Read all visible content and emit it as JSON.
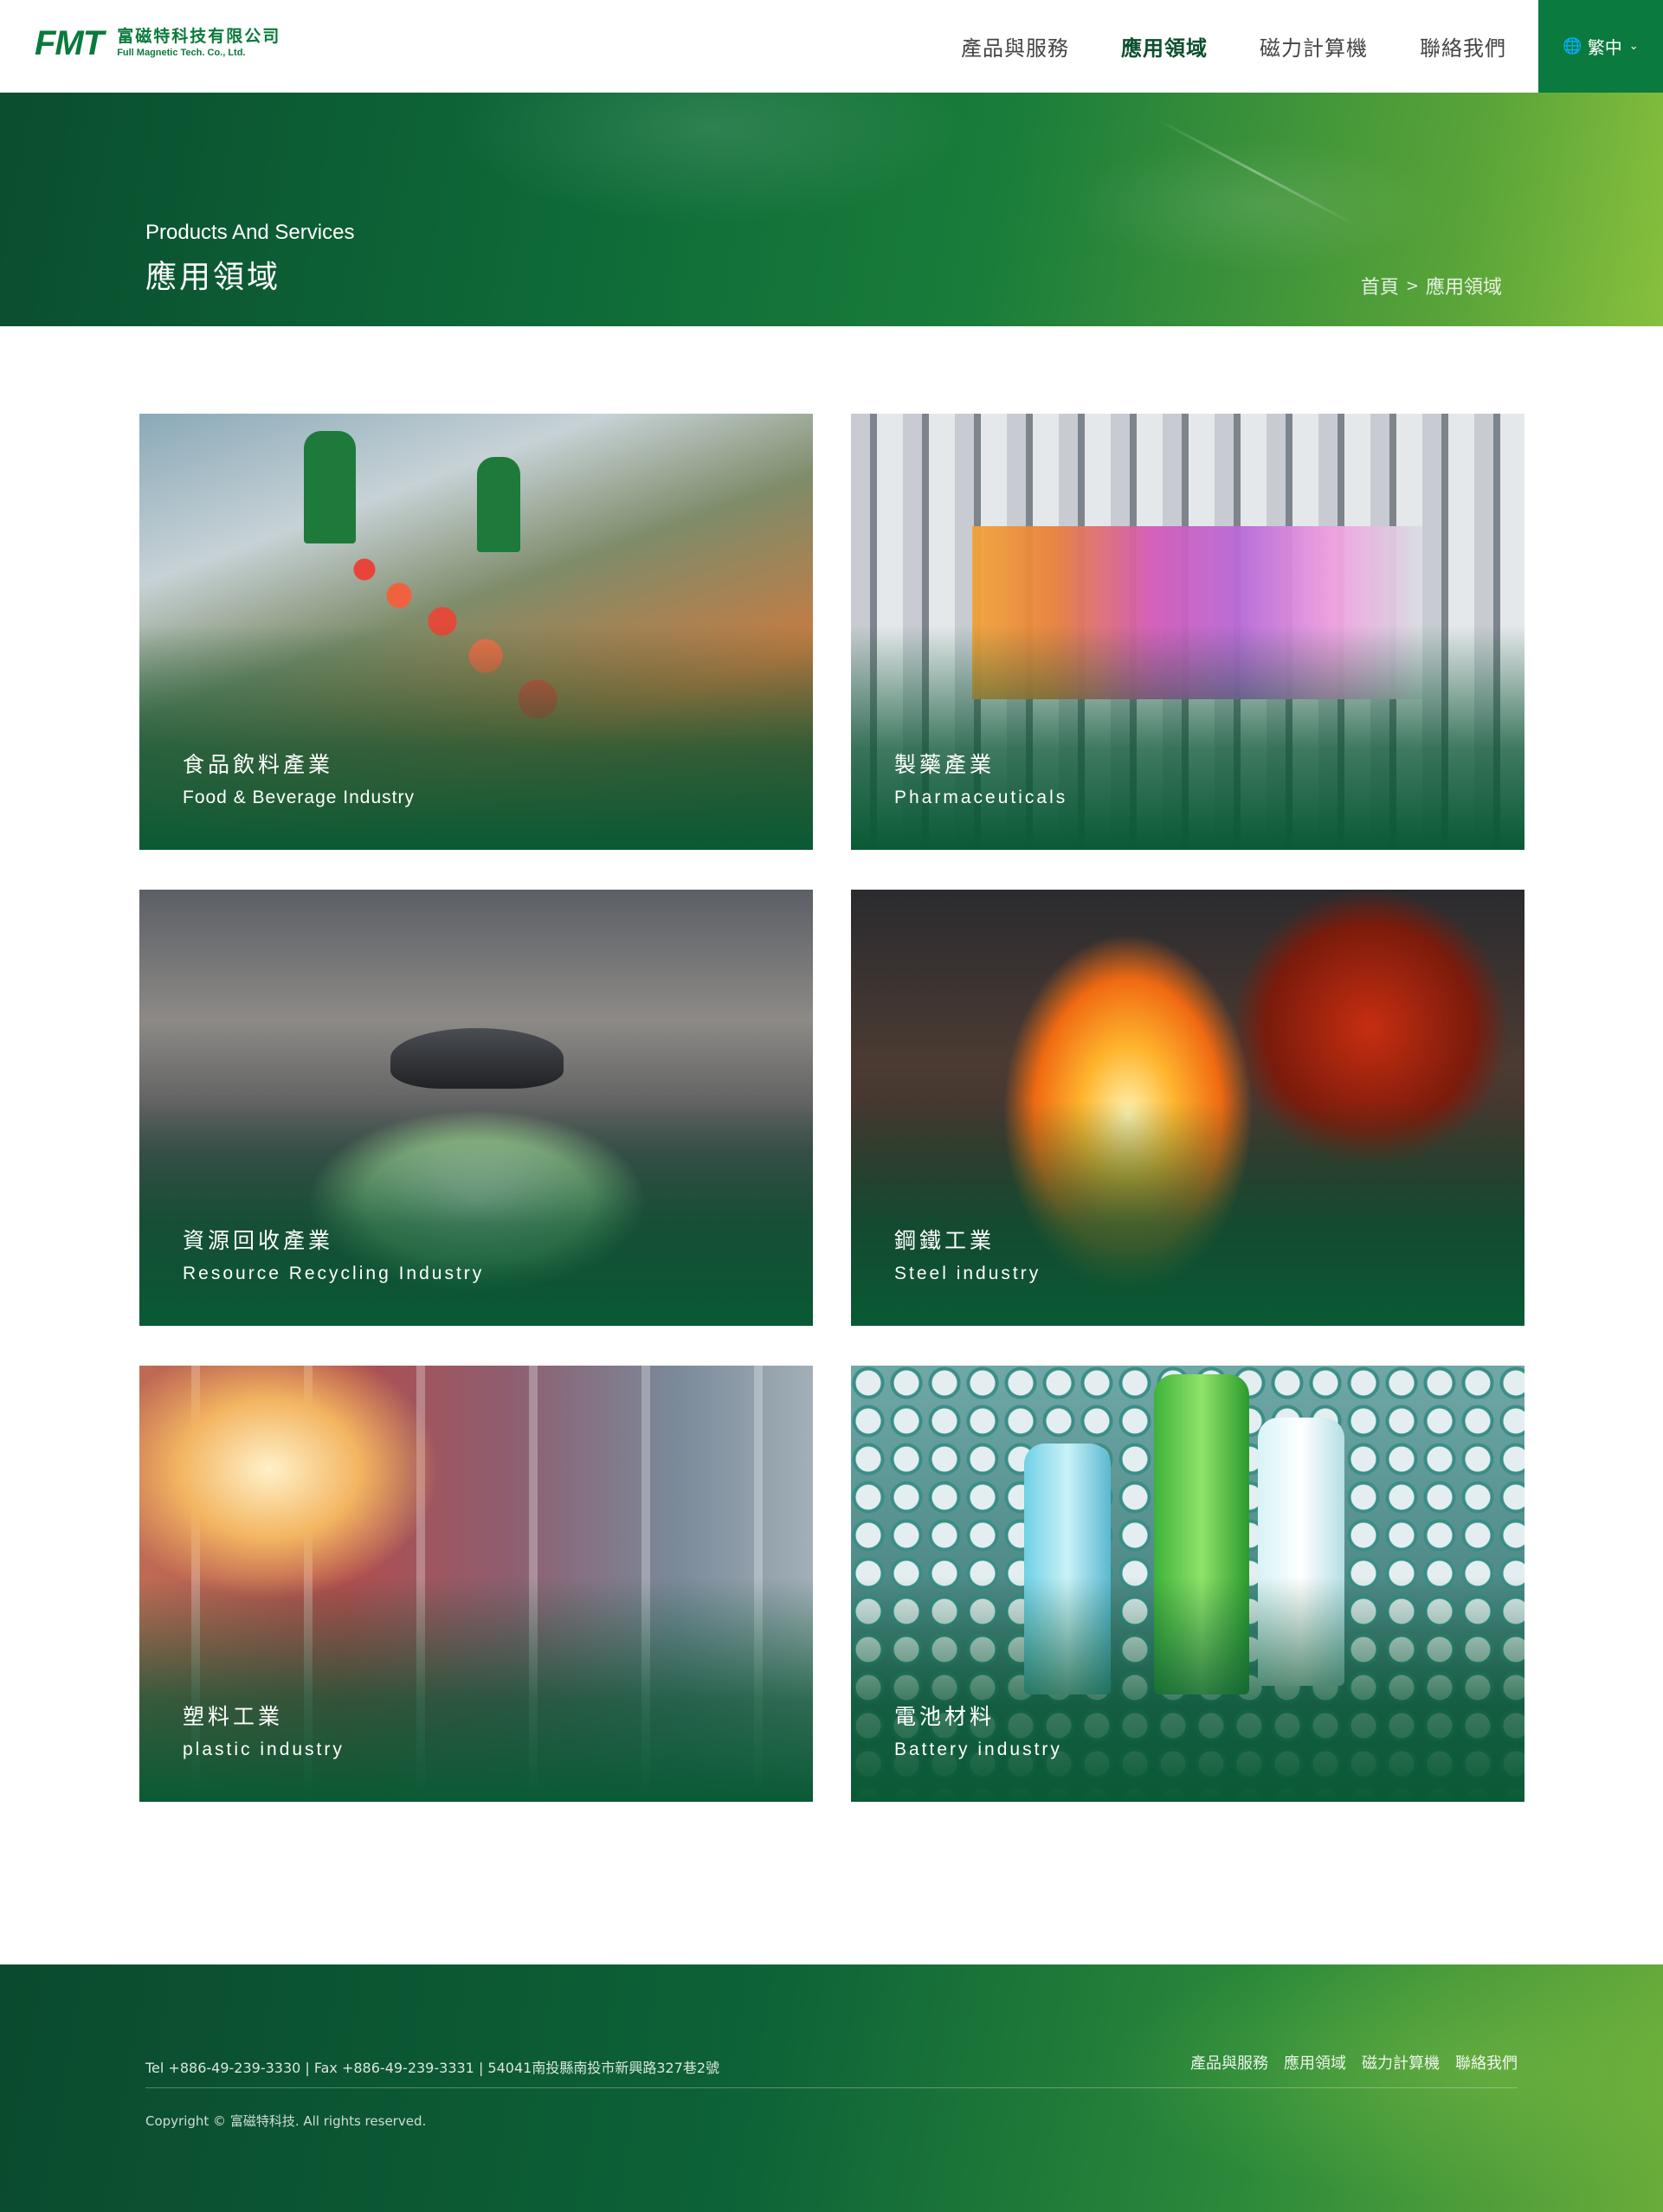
{
  "header": {
    "logo_mark": "FMT",
    "logo_zh": "富磁特科技有限公司",
    "logo_en": "Full Magnetic Tech. Co., Ltd.",
    "nav": [
      {
        "label": "產品與服務"
      },
      {
        "label": "應用領域"
      },
      {
        "label": "磁力計算機"
      },
      {
        "label": "聯絡我們"
      }
    ],
    "language": "繁中"
  },
  "banner": {
    "subtitle": "Products And Services",
    "title": "應用領域",
    "breadcrumb": {
      "home": "首頁",
      "separator": ">",
      "current": "應用領域"
    }
  },
  "industries": [
    {
      "zh": "食品飲料產業",
      "en": "Food & Beverage Industry"
    },
    {
      "zh": "製藥產業",
      "en": "Pharmaceuticals"
    },
    {
      "zh": "資源回收產業",
      "en": "Resource Recycling Industry"
    },
    {
      "zh": "鋼鐵工業",
      "en": "Steel industry"
    },
    {
      "zh": "塑料工業",
      "en": "plastic industry"
    },
    {
      "zh": "電池材料",
      "en": "Battery industry"
    }
  ],
  "footer": {
    "contact": "Tel +886-49-239-3330 |  Fax +886-49-239-3331 | 54041南投縣南投市新興路327巷2號",
    "links": [
      {
        "label": "產品與服務"
      },
      {
        "label": "應用領域"
      },
      {
        "label": "磁力計算機"
      },
      {
        "label": "聯絡我們"
      }
    ],
    "copyright": "Copyright © 富磁特科技. All rights reserved."
  },
  "colors": {
    "brand_green": "#0b7a3e",
    "dark_green": "#0a4d2f",
    "lime": "#88c03d"
  }
}
